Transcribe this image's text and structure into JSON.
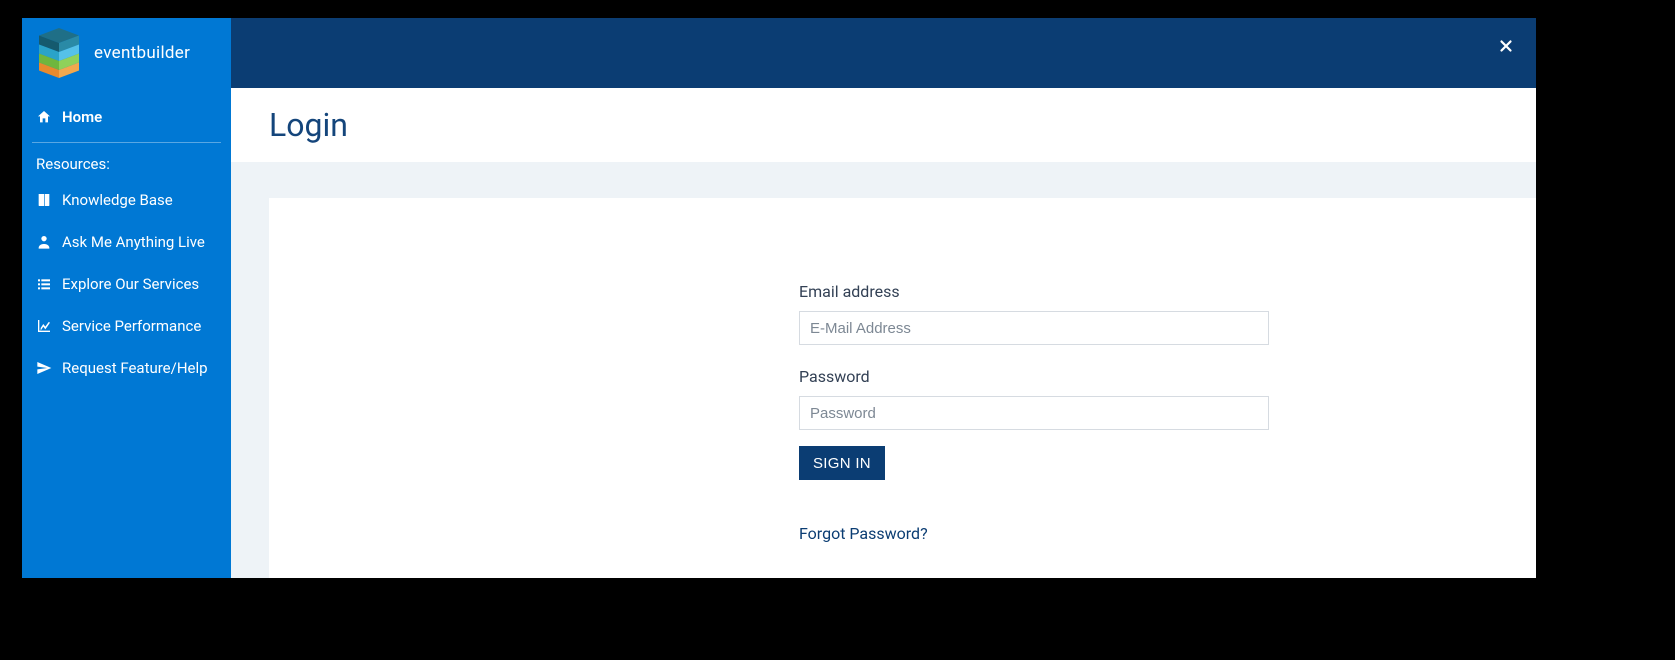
{
  "brand": {
    "name": "eventbuilder"
  },
  "sidebar": {
    "home_label": "Home",
    "section_label": "Resources:",
    "items": [
      {
        "label": "Knowledge Base"
      },
      {
        "label": "Ask Me Anything Live"
      },
      {
        "label": "Explore Our Services"
      },
      {
        "label": "Service Performance"
      },
      {
        "label": "Request Feature/Help"
      }
    ]
  },
  "page": {
    "title": "Login"
  },
  "login_form": {
    "email_label": "Email address",
    "email_placeholder": "E-Mail Address",
    "password_label": "Password",
    "password_placeholder": "Password",
    "signin_label": "SIGN IN",
    "forgot_label": "Forgot Password?"
  }
}
